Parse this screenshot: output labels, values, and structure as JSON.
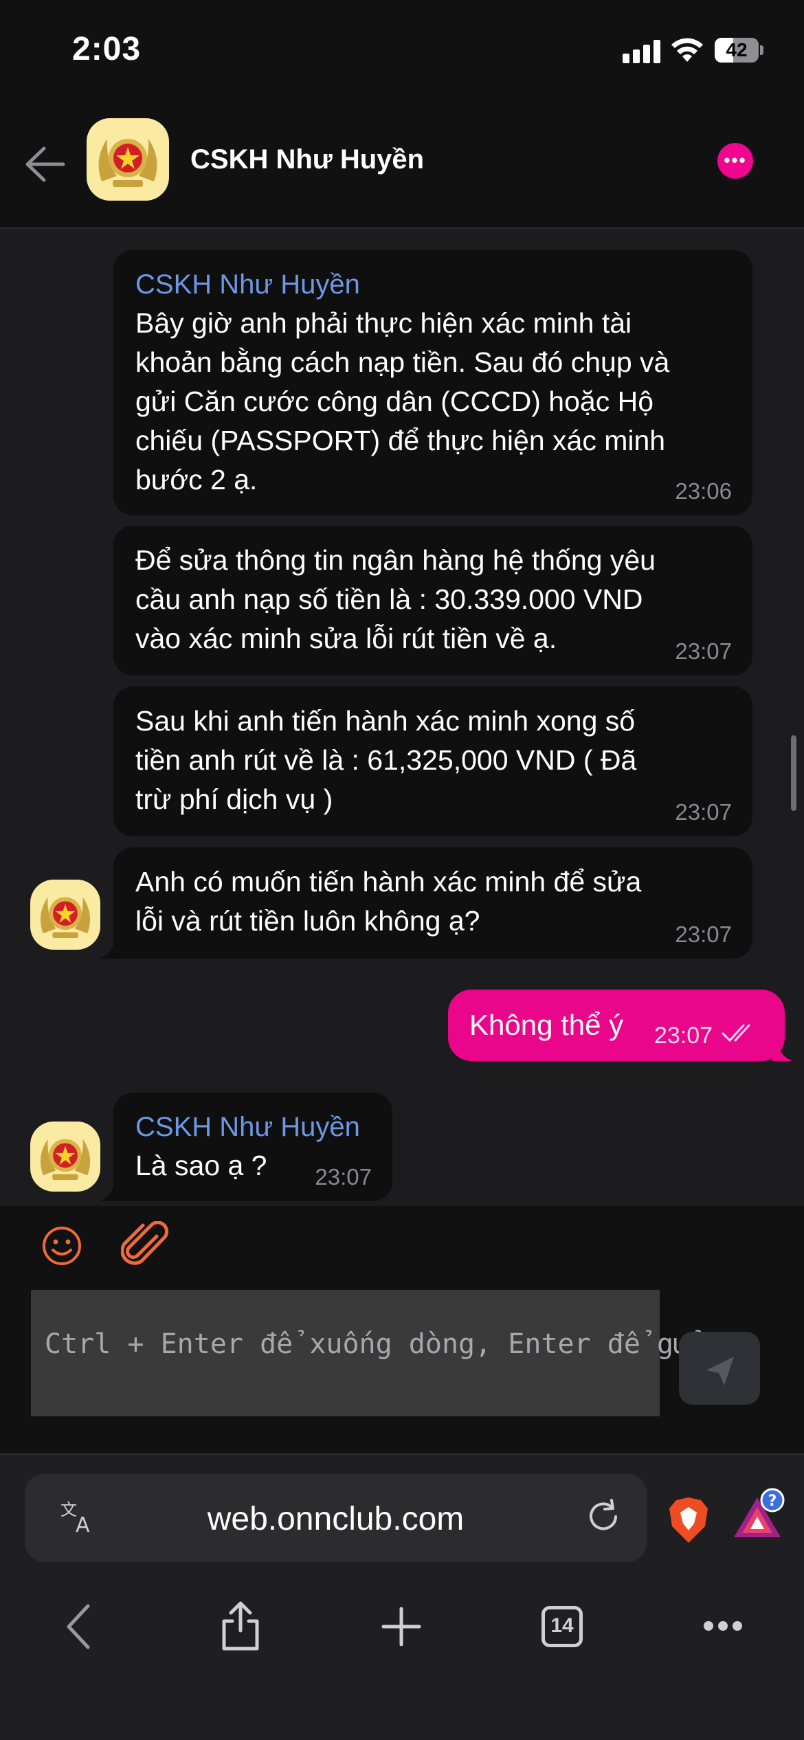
{
  "status_bar": {
    "time": "2:03",
    "battery_level": "42",
    "battery_fraction": 0.42
  },
  "chat_header": {
    "contact_name": "CSKH Như Huyền"
  },
  "messages": [
    {
      "sender": "CSKH Như Huyền",
      "lines": [
        "Bây giờ anh phải thực hiện xác minh tài",
        "khoản bằng cách nạp tiền. Sau đó chụp và",
        "gửi Căn cước công dân (CCCD) hoặc Hộ",
        "chiếu (PASSPORT) để thực hiện xác minh",
        "bước 2 ạ."
      ],
      "time": "23:06"
    },
    {
      "lines": [
        "Để sửa thông tin ngân hàng hệ thống yêu",
        "cầu anh nạp số tiền là : 30.339.000 VND",
        "vào xác minh sửa lỗi rút tiền về ạ."
      ],
      "time": "23:07"
    },
    {
      "lines": [
        "Sau khi anh tiến hành xác minh xong số",
        "tiền anh rút về là : 61,325,000 VND ( Đã",
        "trừ phí dịch vụ )"
      ],
      "time": "23:07"
    },
    {
      "lines": [
        "Anh có muốn tiến hành xác minh để sửa",
        "lỗi và rút tiền luôn không ạ?"
      ],
      "time": "23:07"
    },
    {
      "outgoing": true,
      "text": "Không thể ý",
      "time": "23:07"
    },
    {
      "sender": "CSKH Như Huyền",
      "lines": [
        "Là sao ạ ?"
      ],
      "time": "23:07"
    }
  ],
  "composer": {
    "placeholder": "Ctrl + Enter để xuống dòng, Enter để gửi"
  },
  "browser": {
    "url": "web.onnclub.com",
    "tab_count": "14",
    "badge": "?"
  },
  "colors": {
    "accent": "#ea068a",
    "sender_name": "#6c98e4",
    "incoming_bubble": "#0f0f10",
    "background": "#1c1c1e"
  }
}
